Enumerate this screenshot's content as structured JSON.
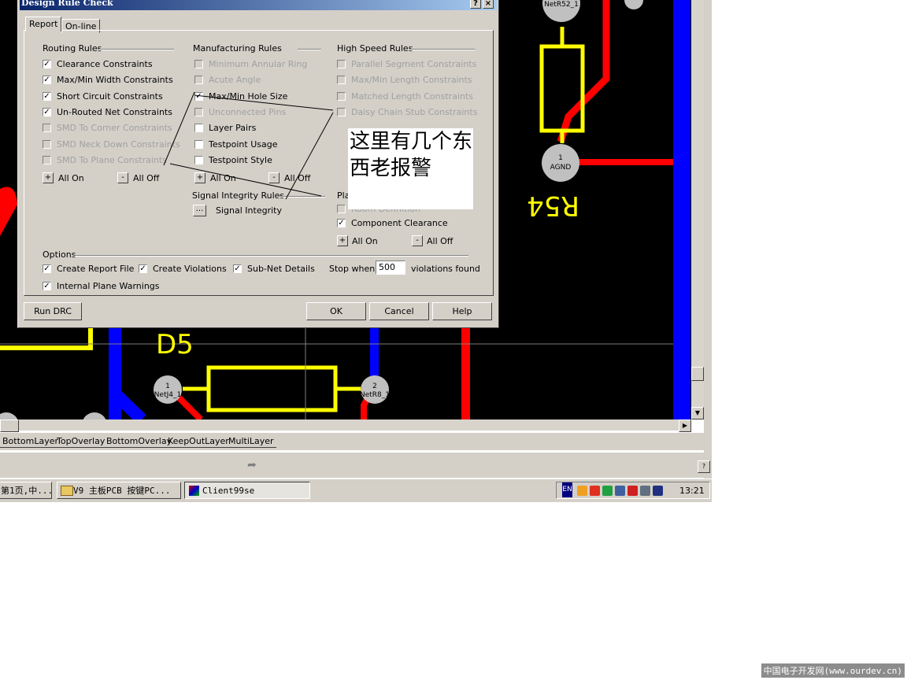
{
  "pcb": {
    "pads": [
      {
        "num": "",
        "net": "NetR52_1"
      },
      {
        "num": "1",
        "net": "AGND"
      },
      {
        "num": "1",
        "net": "NetJ4_1"
      },
      {
        "num": "2",
        "net": "NetR8_1"
      }
    ],
    "designators": [
      "D5",
      "R54"
    ],
    "colors": {
      "background": "#000000",
      "red_trace": "#ff0000",
      "blue_trace": "#0000ff",
      "yellow_overlay": "#ffff00",
      "pad": "#c0c0c0"
    }
  },
  "layer_tabs": [
    "BottomLayer",
    "TopOverlay",
    "BottomOverlay",
    "KeepOutLayer",
    "MultiLayer"
  ],
  "statusbar": {
    "help_icon": "?"
  },
  "taskbar": {
    "buttons": [
      "第1页,中...",
      "V9  主板PCB  按键PC...",
      "Client99se"
    ],
    "tray_lang": "EN",
    "clock": "13:21"
  },
  "dialog": {
    "title": "Design Rule Check",
    "tabs": [
      "Report",
      "On-line"
    ],
    "routing": {
      "heading": "Routing Rules",
      "items": [
        {
          "label": "Clearance Constraints",
          "checked": true,
          "enabled": true
        },
        {
          "label": "Max/Min Width Constraints",
          "checked": true,
          "enabled": true
        },
        {
          "label": "Short Circuit Constraints",
          "checked": true,
          "enabled": true
        },
        {
          "label": "Un-Routed Net Constraints",
          "checked": true,
          "enabled": true
        },
        {
          "label": "SMD To Corner Constraints",
          "checked": false,
          "enabled": false
        },
        {
          "label": "SMD Neck Down Constraints",
          "checked": false,
          "enabled": false
        },
        {
          "label": "SMD To Plane Constraints",
          "checked": false,
          "enabled": false
        }
      ],
      "all_on": "All On",
      "all_off": "All Off"
    },
    "manufacturing": {
      "heading": "Manufacturing Rules",
      "items": [
        {
          "label": "Minimum Annular Ring",
          "checked": false,
          "enabled": false
        },
        {
          "label": "Acute Angle",
          "checked": false,
          "enabled": false
        },
        {
          "label": "Max/Min Hole Size",
          "checked": true,
          "enabled": true
        },
        {
          "label": "Unconnected Pins",
          "checked": false,
          "enabled": false
        },
        {
          "label": "Layer Pairs",
          "checked": false,
          "enabled": true
        },
        {
          "label": "Testpoint Usage",
          "checked": false,
          "enabled": true
        },
        {
          "label": "Testpoint Style",
          "checked": false,
          "enabled": true
        }
      ],
      "all_on": "All On",
      "all_off": "All Off"
    },
    "signal_integrity": {
      "heading": "Signal Integrity Rules",
      "button_label": "...",
      "label": "Signal Integrity"
    },
    "high_speed": {
      "heading": "High Speed Rules",
      "items": [
        {
          "label": "Parallel Segment Constraints",
          "checked": false,
          "enabled": false
        },
        {
          "label": "Max/Min Length Constraints",
          "checked": false,
          "enabled": false
        },
        {
          "label": "Matched Length Constraints",
          "checked": false,
          "enabled": false
        },
        {
          "label": "Daisy Chain Stub Constraints",
          "checked": false,
          "enabled": false
        }
      ]
    },
    "placement": {
      "heading": "Pla",
      "items": [
        {
          "label": "Room Definition",
          "checked": false,
          "enabled": false
        },
        {
          "label": "Component Clearance",
          "checked": true,
          "enabled": true
        }
      ],
      "all_on": "All On",
      "all_off": "All Off"
    },
    "options": {
      "heading": "Options",
      "create_report_file": "Create Report File",
      "create_violations": "Create Violations",
      "sub_net_details": "Sub-Net Details",
      "internal_plane_warnings": "Internal Plane Warnings",
      "stop_when": "Stop when",
      "stop_value": "500",
      "violations_found": "violations found"
    },
    "buttons": {
      "run_drc": "Run DRC",
      "ok": "OK",
      "cancel": "Cancel",
      "help": "Help"
    }
  },
  "annotation": {
    "text": "这里有几个东西老报警"
  },
  "watermark": "中国电子开发网(www.ourdev.cn)"
}
